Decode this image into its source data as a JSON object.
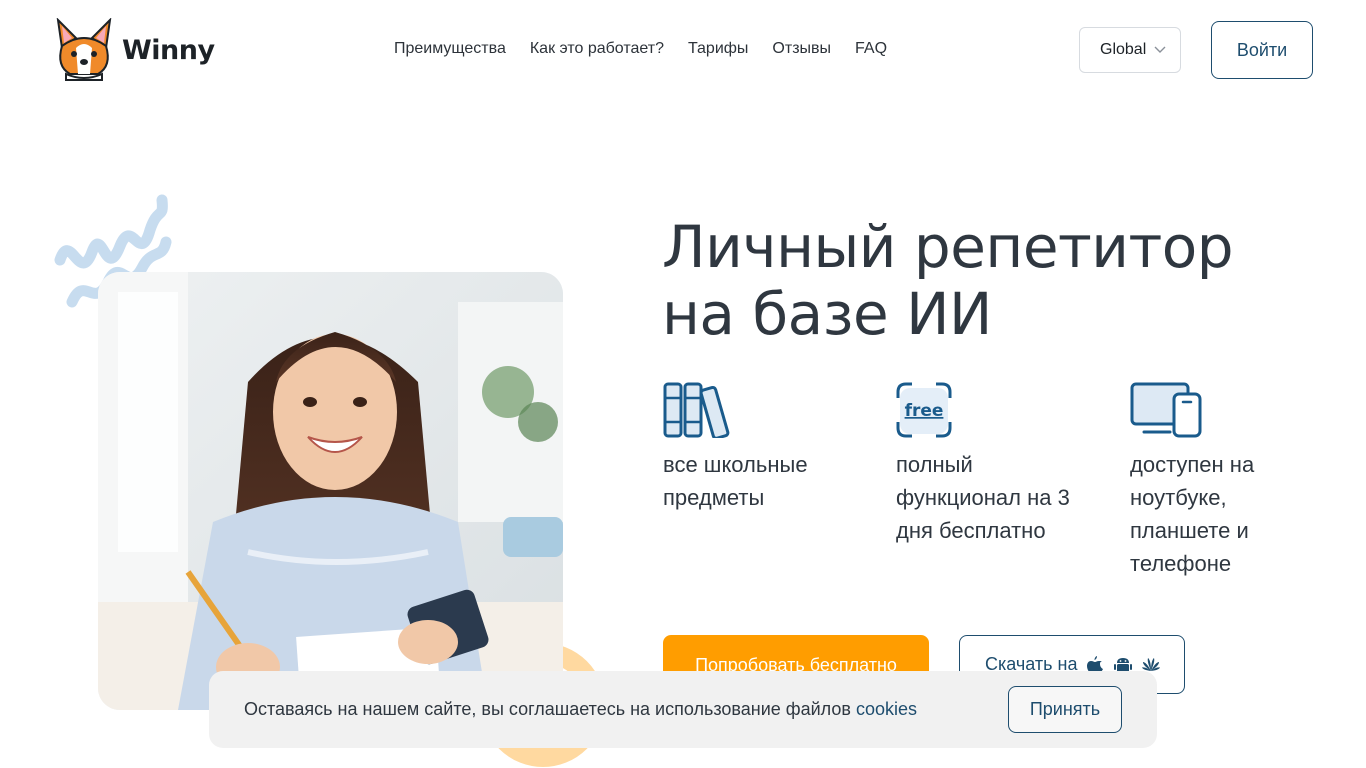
{
  "header": {
    "brand": "Winny",
    "nav": [
      "Преимущества",
      "Как это работает?",
      "Тарифы",
      "Отзывы",
      "FAQ"
    ],
    "region_selected": "Global",
    "login_label": "Войти"
  },
  "hero": {
    "title": "Личный репетитор на базе ИИ",
    "features": [
      {
        "icon": "books-icon",
        "text": "все школьные предметы"
      },
      {
        "icon": "free-icon",
        "text": "полный функционал на 3 дня бесплатно"
      },
      {
        "icon": "devices-icon",
        "text": "доступен на ноутбуке, планшете и телефоне"
      }
    ],
    "free_badge": "free",
    "try_label": "Попробовать бесплатно",
    "download_label": "Скачать на",
    "download_platforms": [
      "apple-icon",
      "android-icon",
      "huawei-icon"
    ]
  },
  "cookie": {
    "text": "Оставаясь на нашем сайте, вы соглашаетесь на использование файлов",
    "link": "cookies",
    "accept_label": "Принять"
  },
  "colors": {
    "accent_orange": "#ff9d00",
    "brand_blue": "#1e4d6e",
    "icon_blue": "#1a5b8c",
    "text_dark": "#2f3740",
    "banner_bg": "#f1f1f1"
  }
}
